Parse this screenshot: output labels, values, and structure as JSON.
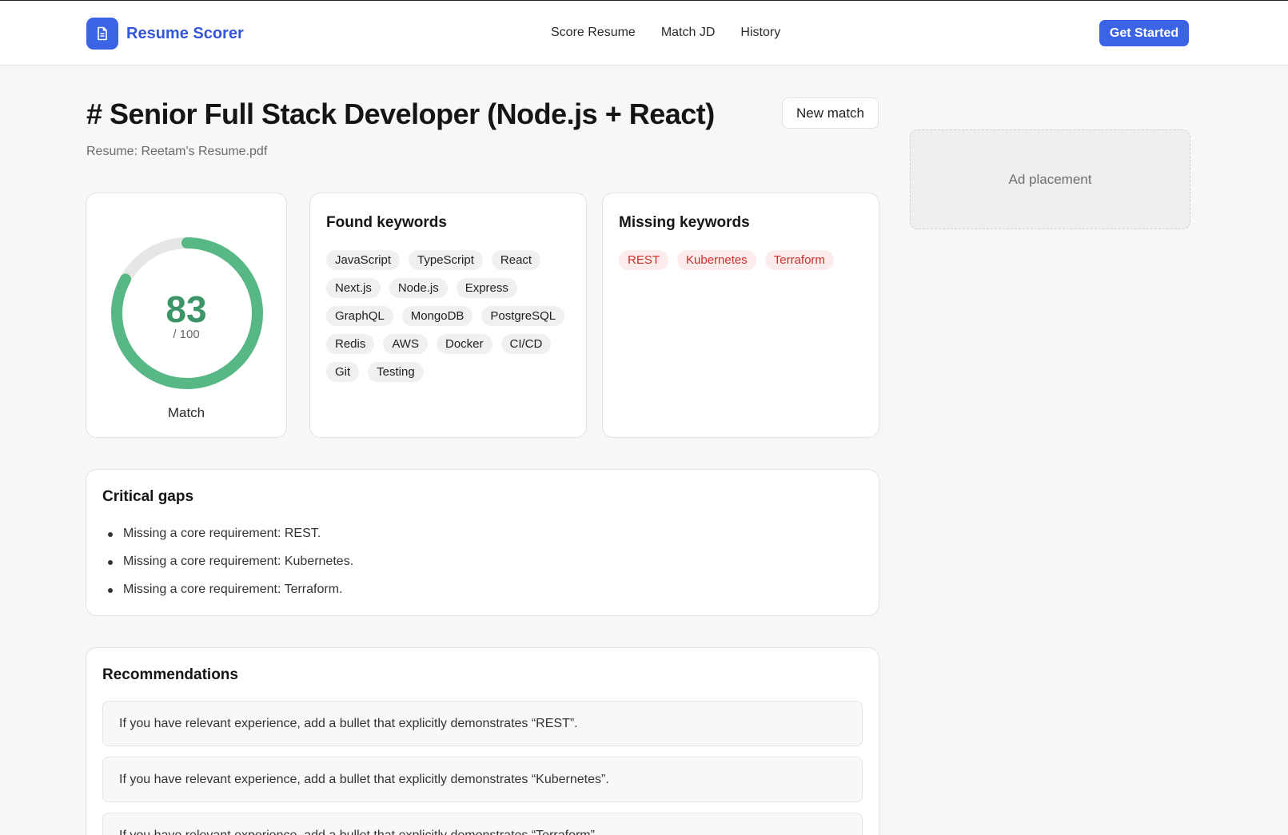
{
  "brand": {
    "name": "Resume Scorer",
    "icon": "document-icon",
    "color": "#3a63e6"
  },
  "nav": {
    "items": [
      "Score Resume",
      "Match JD",
      "History"
    ]
  },
  "header": {
    "cta_label": "Get Started"
  },
  "job": {
    "title": "# Senior Full Stack Developer (Node.js + React)",
    "resume_label": "Resume: Reetam's Resume.pdf",
    "new_match_label": "New match"
  },
  "ad": {
    "label": "Ad placement"
  },
  "score": {
    "value": "83",
    "max_label": "/ 100",
    "label": "Match",
    "fraction": 0.83,
    "color": "#57b886"
  },
  "found": {
    "title": "Found keywords",
    "keywords": [
      "JavaScript",
      "TypeScript",
      "React",
      "Next.js",
      "Node.js",
      "Express",
      "GraphQL",
      "MongoDB",
      "PostgreSQL",
      "Redis",
      "AWS",
      "Docker",
      "CI/CD",
      "Git",
      "Testing"
    ]
  },
  "missing": {
    "title": "Missing keywords",
    "keywords": [
      "REST",
      "Kubernetes",
      "Terraform"
    ],
    "color": "#c9302c"
  },
  "gaps": {
    "title": "Critical gaps",
    "items": [
      "Missing a core requirement: REST.",
      "Missing a core requirement: Kubernetes.",
      "Missing a core requirement: Terraform."
    ]
  },
  "recommendations": {
    "title": "Recommendations",
    "items": [
      "If you have relevant experience, add a bullet that explicitly demonstrates “REST”.",
      "If you have relevant experience, add a bullet that explicitly demonstrates “Kubernetes”.",
      "If you have relevant experience, add a bullet that explicitly demonstrates “Terraform”."
    ]
  }
}
